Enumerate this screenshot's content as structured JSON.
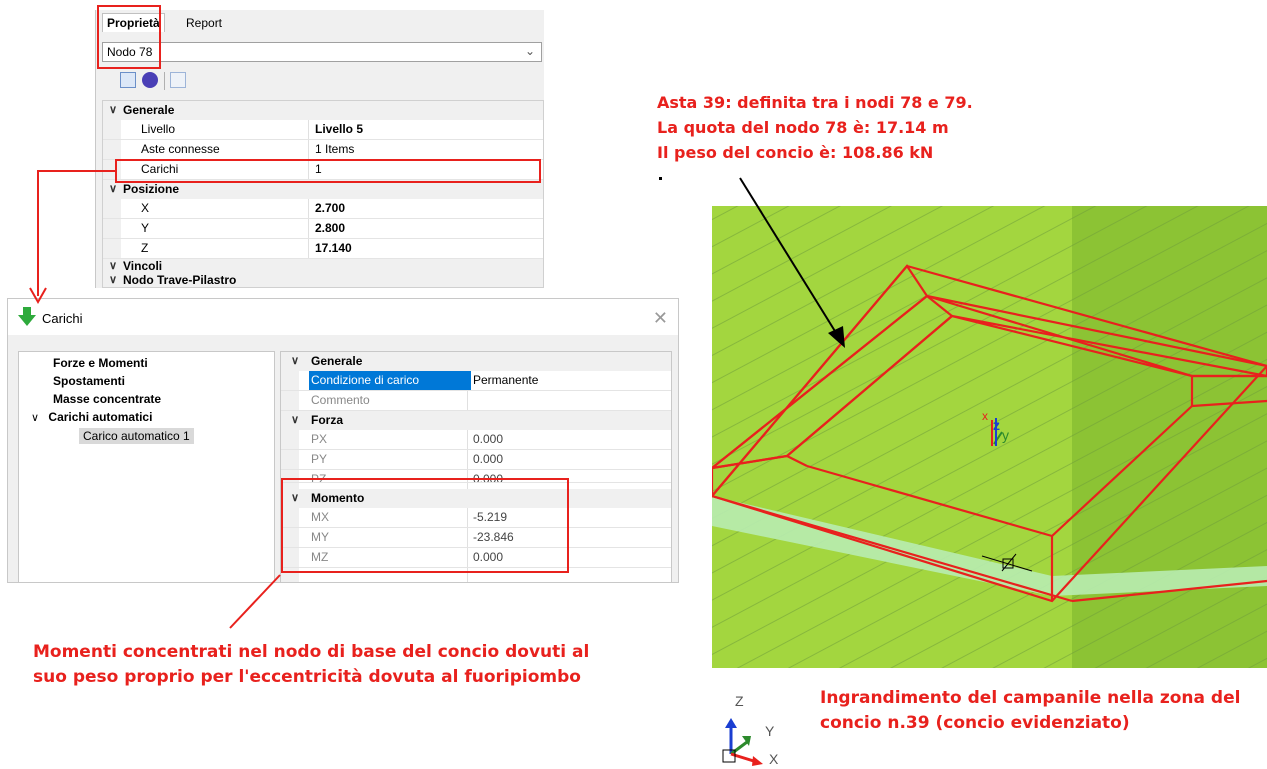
{
  "properties_panel": {
    "tabs": [
      "Proprietà",
      "Report"
    ],
    "selected_node": "Nodo 78",
    "sections": [
      {
        "label": "Generale",
        "rows": [
          {
            "key": "Livello",
            "value": "Livello 5",
            "bold": true
          },
          {
            "key": "Aste connesse",
            "value": "1 Items",
            "bold": false
          },
          {
            "key": "Carichi",
            "value": "1",
            "bold": false
          }
        ]
      },
      {
        "label": "Posizione",
        "rows": [
          {
            "key": "X",
            "value": "2.700",
            "bold": true
          },
          {
            "key": "Y",
            "value": "2.800",
            "bold": true
          },
          {
            "key": "Z",
            "value": "17.140",
            "bold": true
          }
        ]
      },
      {
        "label": "Vincoli",
        "rows": []
      },
      {
        "label": "Nodo Trave-Pilastro",
        "rows": []
      }
    ]
  },
  "loads_dialog": {
    "title": "Carichi",
    "tree": {
      "items": [
        "Forze e Momenti",
        "Spostamenti",
        "Masse concentrate"
      ],
      "group_label": "Carichi automatici",
      "selected_child": "Carico automatico 1"
    },
    "grid": {
      "generale_label": "Generale",
      "condizione_label": "Condizione di carico",
      "condizione_value": "Permanente",
      "commento_label": "Commento",
      "forza_label": "Forza",
      "px_label": "PX",
      "px_value": "0.000",
      "py_label": "PY",
      "py_value": "0.000",
      "pz_label": "PZ",
      "pz_value": "0.000",
      "momento_label": "Momento",
      "mx_label": "MX",
      "mx_value": "-5.219",
      "my_label": "MY",
      "my_value": "-23.846",
      "mz_label": "MZ",
      "mz_value": "0.000"
    }
  },
  "annotations": {
    "asta_line1": "Asta 39: definita tra i nodi 78 e 79.",
    "asta_line2": "La quota del nodo 78 è: 17.14 m",
    "asta_line3": "Il peso del concio è: 108.86 kN",
    "momenti_line1": "Momenti concentrati nel nodo di base del concio dovuti al",
    "momenti_line2": "suo peso proprio per l'eccentricità dovuta al fuoripiombo",
    "ingr_line1": "Ingrandimento del campanile nella zona del",
    "ingr_line2": "concio n.39 (concio evidenziato)"
  },
  "view3d": {
    "local_axes": {
      "x": "x",
      "y": "y",
      "z": "z"
    },
    "gizmo": {
      "z": "Z",
      "y": "Y",
      "x": "X"
    }
  },
  "colors": {
    "annotation_red": "#e8211d",
    "highlight_blue": "#0078d7",
    "wall_green": "#9dd43a",
    "wall_green_dark": "#82bf2a",
    "slab_light_green": "#b6ecb0"
  }
}
